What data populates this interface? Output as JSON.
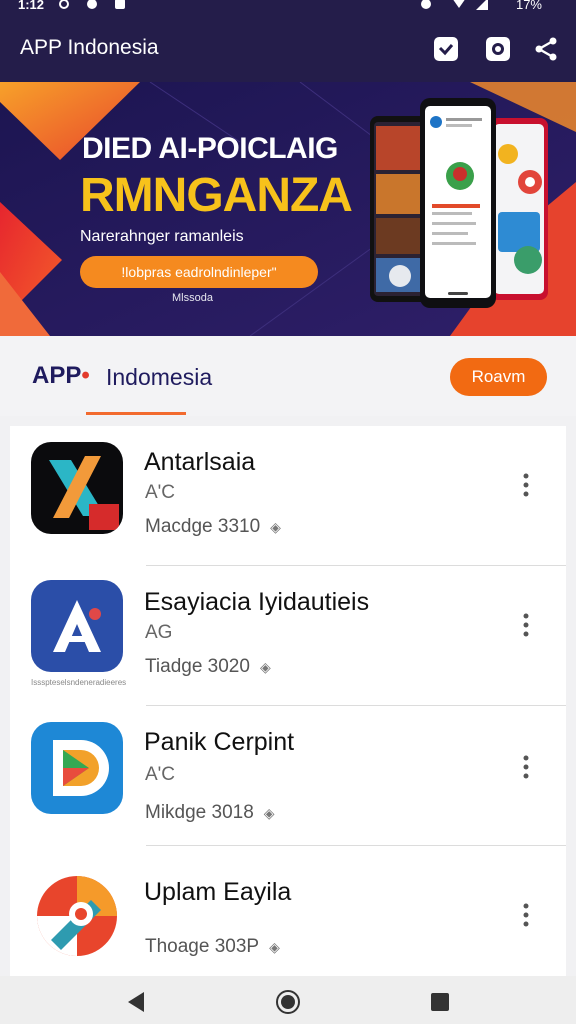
{
  "status_bar": {
    "time": "1:12",
    "battery": "17%"
  },
  "app_bar": {
    "title": "APP Indonesia"
  },
  "banner": {
    "line1": "DIED AI-POICLAIG",
    "line2": "RMNGANZA",
    "line3": "Narerahnger ramanleis",
    "cta": "!lobpras eadrolndinleper\"",
    "footnote": "Mlssoda"
  },
  "section": {
    "brand": "APP",
    "brand_sub": "Indomesia",
    "button": "Roavm"
  },
  "apps": [
    {
      "name": "Antarlsaia",
      "developer": "A'C",
      "meta": "Macdge 3310",
      "icon": "x-logo-icon"
    },
    {
      "name": "Esayiacia Iyidautieis",
      "developer": "AG",
      "meta": "Tiadge 3020",
      "icon": "a-logo-icon",
      "caption": "Issspteselsndeneradieeres"
    },
    {
      "name": "Panik Cerpint",
      "developer": "A'C",
      "meta": "Mikdge 3018",
      "icon": "d-logo-icon"
    },
    {
      "name": "Uplam Eayila",
      "developer": "",
      "meta": "Thoage 303P",
      "icon": "compass-logo-icon"
    }
  ],
  "colors": {
    "app_bar": "#241d4a",
    "accent": "#f26a12",
    "banner_bg": "#231a5a",
    "banner_yellow": "#f7c21b"
  }
}
